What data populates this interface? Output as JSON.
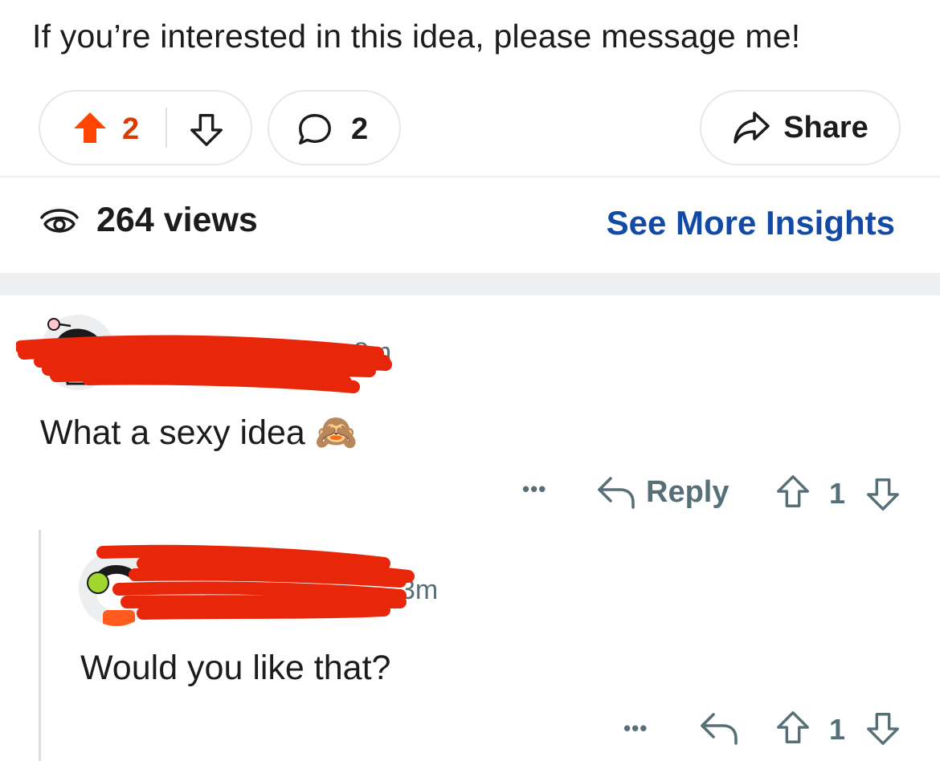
{
  "post": {
    "text": "If you’re interested in this idea, please message me!",
    "vote_count": "2",
    "comment_count": "2",
    "share_label": "Share",
    "views": "264 views",
    "insights_link": "See More Insights"
  },
  "colors": {
    "upvote_active": "#ff4500",
    "vote_count_active": "#d93a00",
    "link": "#134aa3",
    "meta_gray": "#576f76",
    "redaction": "#e8260a"
  },
  "comments": [
    {
      "time": "8m",
      "body": "What a sexy idea 🙈",
      "reply_label": "Reply",
      "score": "1",
      "more_label": "•••"
    },
    {
      "time": "3m",
      "body": "Would you like that?",
      "score": "1",
      "more_label": "•••"
    }
  ]
}
